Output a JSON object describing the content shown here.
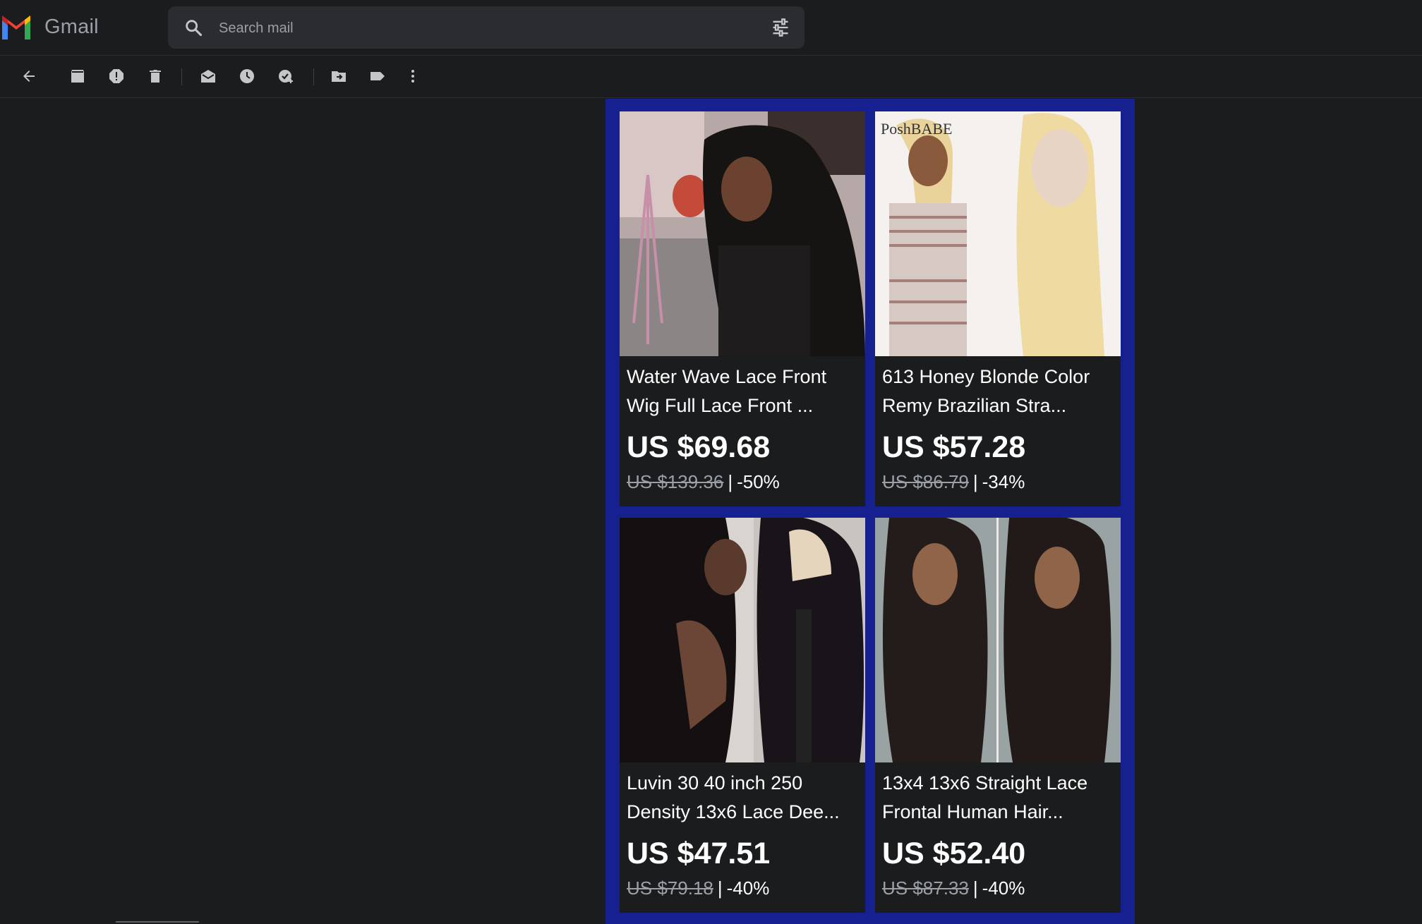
{
  "app": {
    "name": "Gmail"
  },
  "search": {
    "placeholder": "Search mail",
    "value": ""
  },
  "toolbar": {
    "buttons": [
      "back-icon",
      "archive-icon",
      "report-spam-icon",
      "delete-icon",
      "mark-unread-icon",
      "snooze-icon",
      "add-task-icon",
      "move-to-icon",
      "labels-icon",
      "more-icon"
    ]
  },
  "products": [
    {
      "title": "Water Wave Lace Front Wig Full Lace Front ...",
      "price": "US $69.68",
      "old_price": "US $139.36",
      "separator": "|",
      "discount": "-50%"
    },
    {
      "title": "613 Honey Blonde Color Remy Brazilian Stra...",
      "price": "US $57.28",
      "old_price": "US $86.79",
      "separator": "|",
      "discount": "-34%",
      "image_watermark": "PoshBABE"
    },
    {
      "title": "Luvin 30 40 inch 250 Density 13x6 Lace Dee...",
      "price": "US $47.51",
      "old_price": "US $79.18",
      "separator": "|",
      "discount": "-40%"
    },
    {
      "title": "13x4 13x6 Straight Lace Frontal Human Hair...",
      "price": "US $52.40",
      "old_price": "US $87.33",
      "separator": "|",
      "discount": "-40%"
    }
  ],
  "colors": {
    "background": "#1b1c1e",
    "panel": "#16218f",
    "text": "#ffffff",
    "muted": "#9aa0a6"
  }
}
